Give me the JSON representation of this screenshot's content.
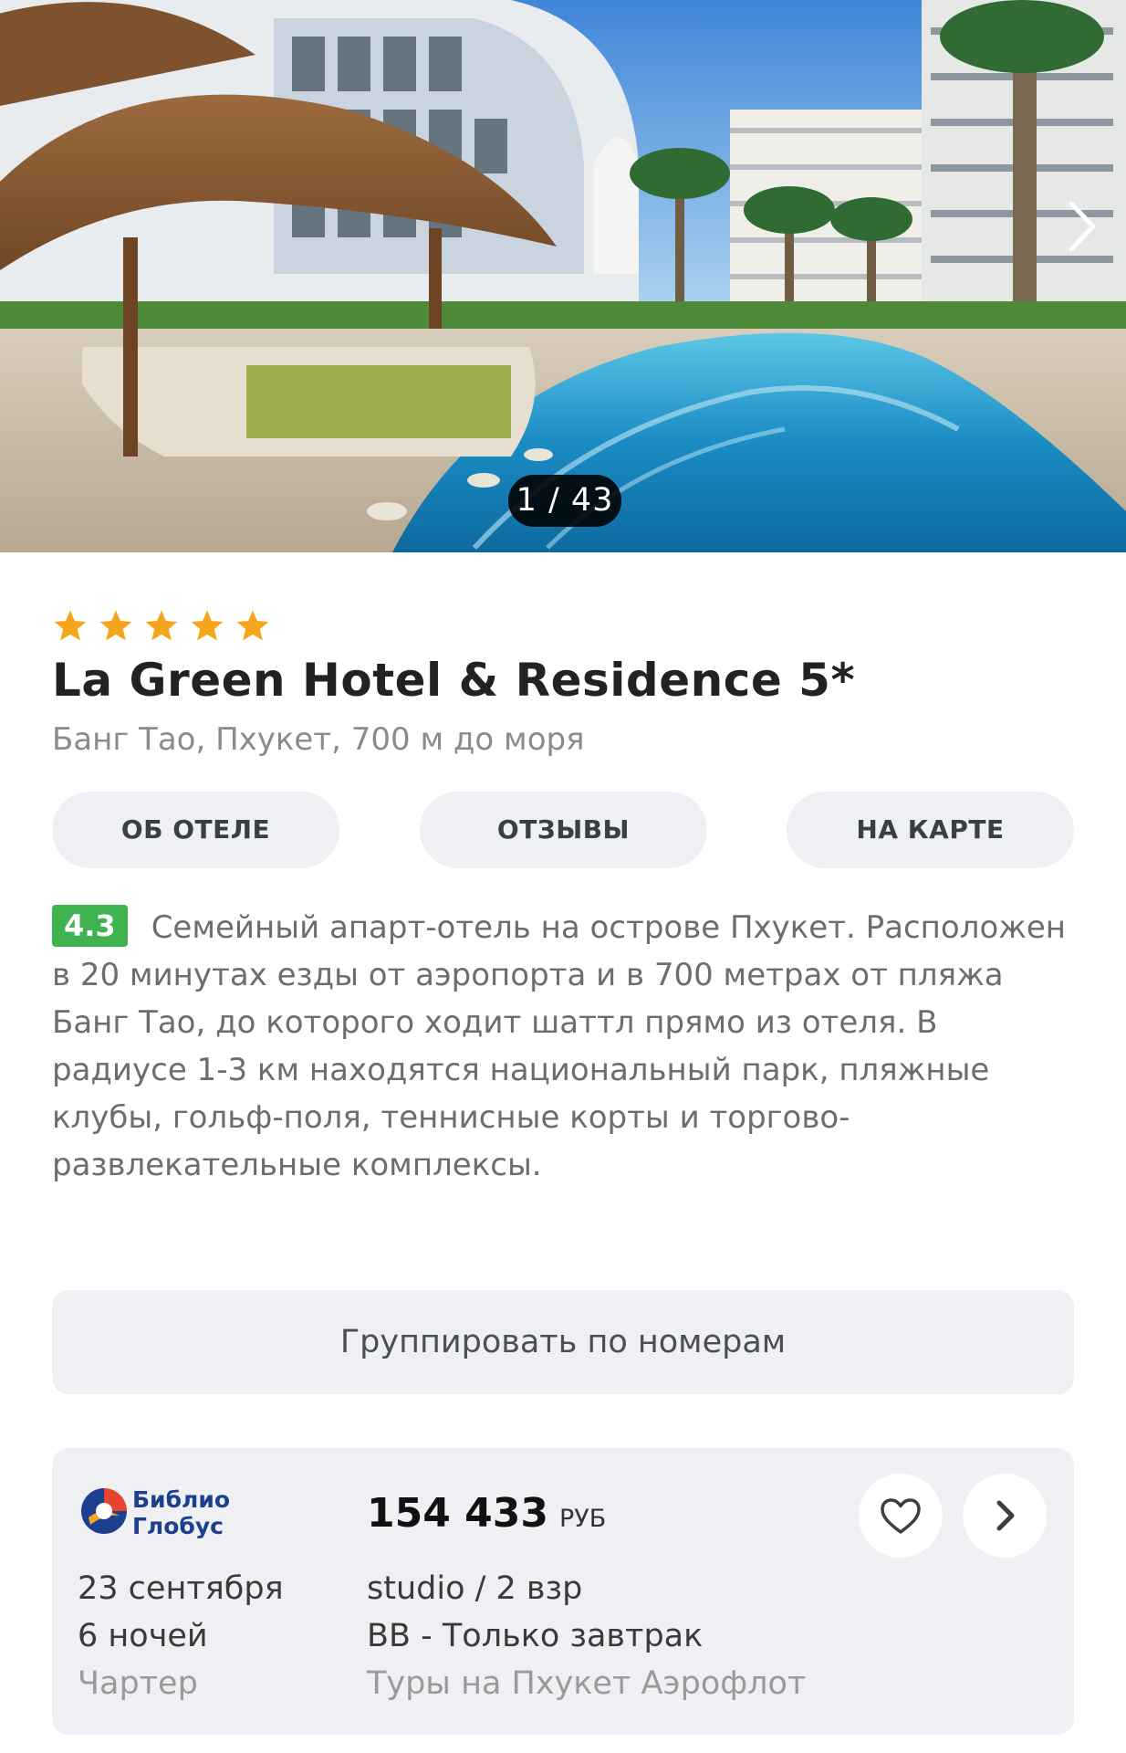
{
  "gallery": {
    "counter": "1 / 43",
    "next_icon": "chevron-right-icon"
  },
  "hotel": {
    "stars": 5,
    "star_color": "#f4a51c",
    "name": "La Green Hotel & Residence 5*",
    "location": "Банг Тао, Пхукет, 700 м до моря"
  },
  "tabs": [
    {
      "label": "ОБ ОТЕЛЕ"
    },
    {
      "label": "ОТЗЫВЫ"
    },
    {
      "label": "НА КАРТЕ"
    }
  ],
  "description": {
    "rating": "4.3",
    "rating_color": "#3fb34f",
    "text": "Семейный апарт-отель на острове Пхукет. Расположен в 20 минутах езды от аэропорта и в 700 метрах от пляжа Банг Тао, до которого ходит шаттл прямо из отеля. В радиусе 1-3 км находятся национальный парк, пляжные клубы, гольф-поля, теннисные корты и торгово-развлекательные комплексы."
  },
  "group_button": {
    "label": "Группировать по номерам"
  },
  "offer": {
    "operator_line1": "Библио",
    "operator_line2": "Глобус",
    "price": "154 433",
    "currency": "РУБ",
    "date": "23 сентября",
    "nights": "6 ночей",
    "flight_type": "Чартер",
    "room": "studio / 2 взр",
    "meal": "BB - Только завтрак",
    "tour_name": "Туры на Пхукет Аэрофлот",
    "favorite_icon": "heart-icon",
    "open_icon": "chevron-right-icon"
  }
}
